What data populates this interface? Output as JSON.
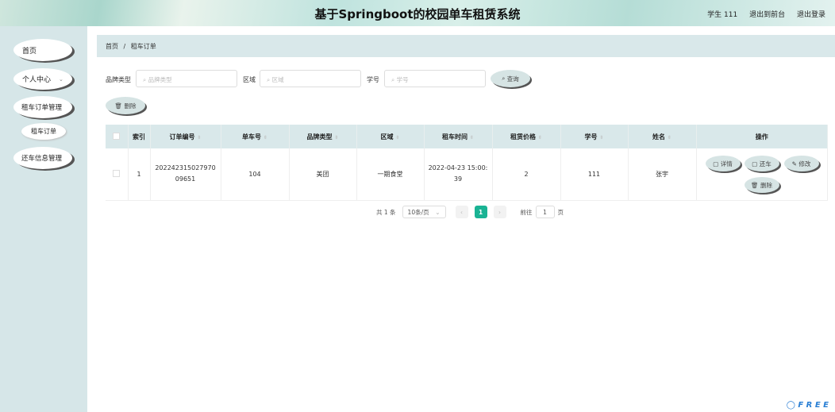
{
  "header": {
    "title": "基于Springboot的校园单车租赁系统",
    "user": "学生 111",
    "back_to_front": "退出到前台",
    "logout": "退出登录"
  },
  "sidebar": {
    "items": [
      {
        "label": "首页"
      },
      {
        "label": "个人中心",
        "chevron": "⌄"
      },
      {
        "label": "租车订单管理"
      },
      {
        "label": "租车订单"
      },
      {
        "label": "还车信息管理"
      }
    ]
  },
  "breadcrumb": {
    "home": "首页",
    "sep": "/",
    "current": "租车订单"
  },
  "search": {
    "brand_label": "品牌类型",
    "brand_placeholder": "品牌类型",
    "region_label": "区域",
    "region_placeholder": "区域",
    "student_label": "学号",
    "student_placeholder": "学号",
    "query_button": "查询"
  },
  "toolbar": {
    "delete_button": "删除"
  },
  "table": {
    "headers": [
      "索引",
      "订单编号",
      "单车号",
      "品牌类型",
      "区域",
      "租车时间",
      "租赁价格",
      "学号",
      "姓名",
      "操作"
    ],
    "rows": [
      {
        "index": "1",
        "order_no": "20224231502797009651",
        "bike_no": "104",
        "brand": "美团",
        "region": "一期食堂",
        "time": "2022-04-23 15:00:39",
        "price": "2",
        "student_no": "111",
        "name": "张宇"
      }
    ],
    "actions": {
      "detail": "详情",
      "return": "还车",
      "edit": "修改",
      "delete": "删除"
    }
  },
  "pagination": {
    "total": "共 1 条",
    "page_size": "10条/页",
    "current_page": "1",
    "goto_label": "前往",
    "goto_value": "1",
    "page_suffix": "页"
  },
  "watermark": "FREE"
}
